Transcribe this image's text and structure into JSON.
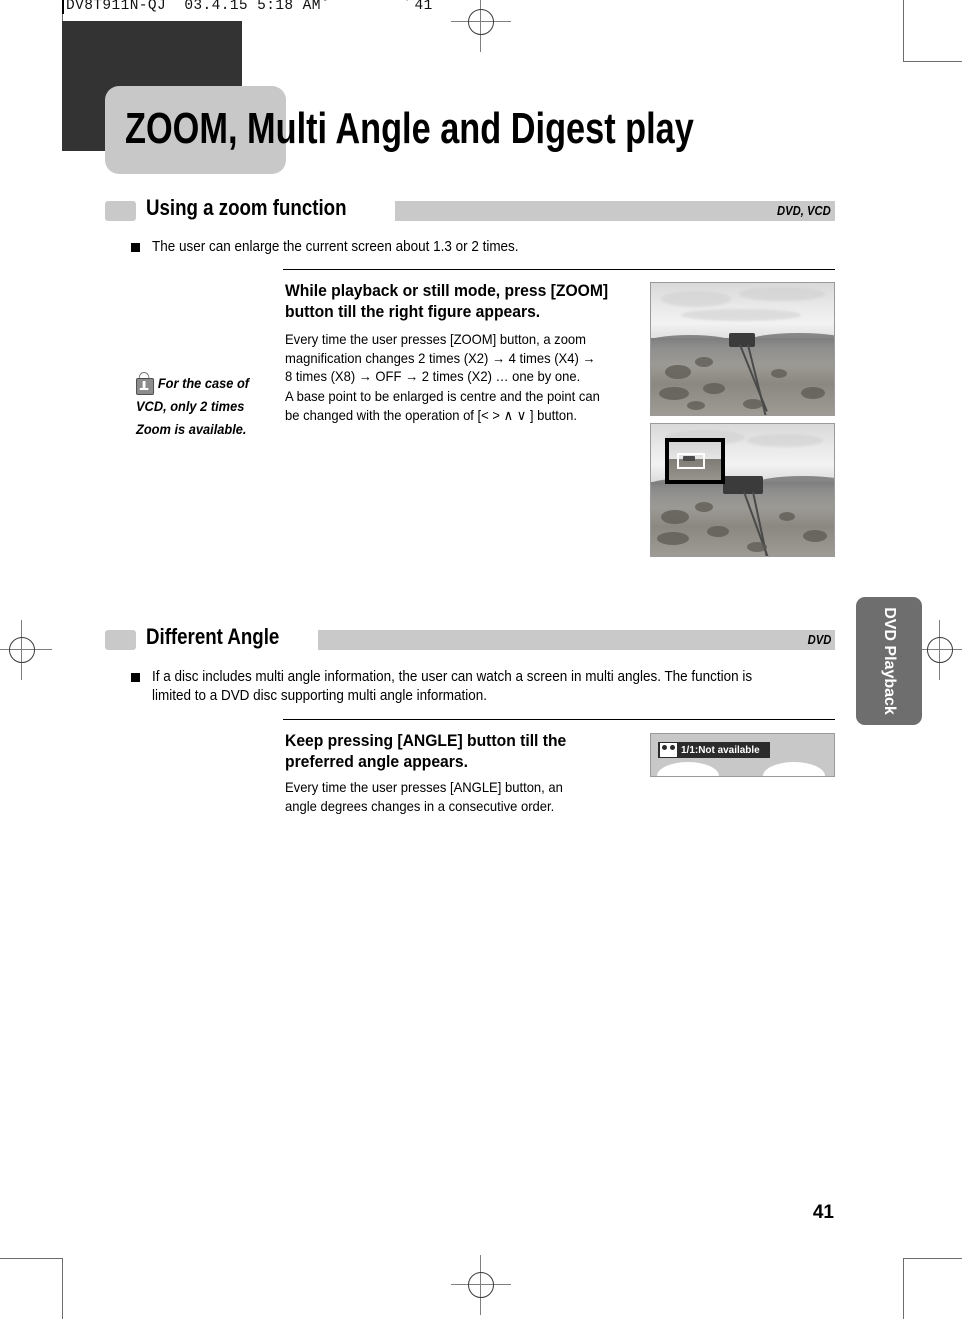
{
  "header": {
    "film_code": "DV8T911N-QJ  03.4.15 5:18 AM",
    "film_marks": "˘      ˋ",
    "film_page": "41"
  },
  "title": "ZOOM, Multi Angle and Digest play",
  "side_tab": {
    "label": "DVD Playback"
  },
  "sections": [
    {
      "title": "Using a zoom function",
      "media": "DVD, VCD",
      "bullet": "The user can enlarge the current screen about 1.3 or 2 times.",
      "step_heading": "While playback or still mode, press [ZOOM] button till the right figure appears.",
      "paragraph_1": "Every time the user presses [ZOOM] button, a zoom magnification changes 2 times (X2) → 4 times (X4)  → 8 times (X8)  → OFF → 2 times (X2) … one by one.",
      "paragraph_2": "A base point to be enlarged is centre and the point can be changed with the operation of [< > ∧ ∨ ] button.",
      "note": "For the case of VCD, only 2 times Zoom is available.",
      "note_icon": "info-icon"
    },
    {
      "title": "Different Angle",
      "media": "DVD",
      "bullet": "If a disc includes multi angle information, the user can watch a screen in multi angles. The function is limited to a DVD disc supporting multi angle information.",
      "step_heading": "Keep pressing [ANGLE] button till the preferred angle appears.",
      "paragraph_1": "Every time the user presses [ANGLE] button, an angle degrees changes in a consecutive order.",
      "osd_label": "1/1:Not available",
      "osd_icon": "camera-icon"
    }
  ],
  "figures": {
    "photo_1_caption": "train on railroad track, normal view",
    "photo_2_caption": "train on railroad track, zoomed with inset box"
  },
  "footer": {
    "page_number": "41"
  },
  "colors": {
    "chip_gray": "#c9c9c9",
    "tab_gray": "#6e6e6e",
    "block_black": "#333333",
    "osd_dark": "#2b2b2b"
  }
}
